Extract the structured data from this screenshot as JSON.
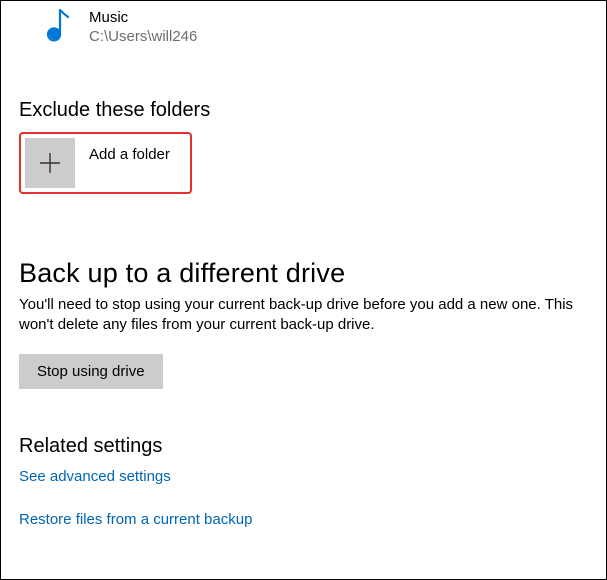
{
  "folder_item": {
    "icon": "music-icon",
    "name": "Music",
    "path": "C:\\Users\\will246"
  },
  "exclude_section": {
    "heading": "Exclude these folders",
    "add_button_label": "Add a folder"
  },
  "backup_section": {
    "heading": "Back up to a different drive",
    "body": "You'll need to stop using your current back-up drive before you add a new one. This won't delete any files from your current back-up drive.",
    "button_label": "Stop using drive"
  },
  "related_section": {
    "heading": "Related settings",
    "link_advanced": "See advanced settings",
    "link_restore": "Restore files from a current backup"
  },
  "colors": {
    "link": "#0066b4",
    "highlight_border": "#e03030",
    "button_bg": "#cccccc"
  }
}
